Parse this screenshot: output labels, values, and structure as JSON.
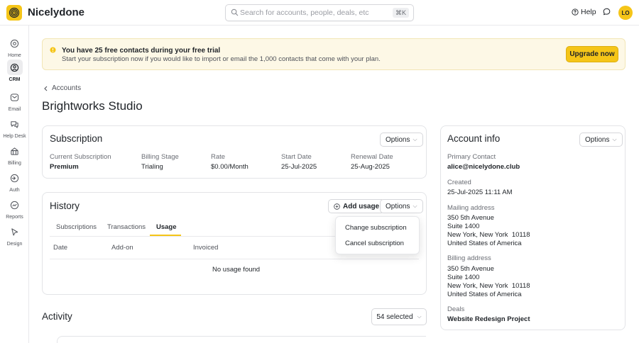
{
  "app": {
    "name": "Nicelydone"
  },
  "search": {
    "placeholder": "Search for accounts, people, deals, etc",
    "shortcut": "⌘K"
  },
  "header": {
    "help_label": "Help",
    "avatar_initials": "LO"
  },
  "sidebar": {
    "items": [
      {
        "label": "Home",
        "icon": "home-icon"
      },
      {
        "label": "CRM",
        "icon": "crm-icon",
        "active": true
      },
      {
        "label": "Email",
        "icon": "email-icon"
      },
      {
        "label": "Help Desk",
        "icon": "help-desk-icon"
      },
      {
        "label": "Billing",
        "icon": "billing-icon"
      },
      {
        "label": "Auth",
        "icon": "auth-icon"
      },
      {
        "label": "Reports",
        "icon": "reports-icon"
      },
      {
        "label": "Design",
        "icon": "design-icon"
      }
    ]
  },
  "banner": {
    "title": "You have 25 free contacts during your free trial",
    "subtitle": "Start your subscription now if you would like to import or email the 1,000 contacts that come with your plan.",
    "cta": "Upgrade now"
  },
  "breadcrumb": {
    "back_label": "Accounts"
  },
  "page": {
    "title": "Brightworks Studio"
  },
  "subscription": {
    "title": "Subscription",
    "options_label": "Options",
    "fields": [
      {
        "label": "Current Subscription",
        "value": "Premium"
      },
      {
        "label": "Billing Stage",
        "value": "Trialing"
      },
      {
        "label": "Rate",
        "value": "$0.00/Month"
      },
      {
        "label": "Start Date",
        "value": "25-Jul-2025"
      },
      {
        "label": "Renewal Date",
        "value": "25-Aug-2025"
      }
    ]
  },
  "history": {
    "title": "History",
    "add_usage_label": "Add usage",
    "options_label": "Options",
    "tabs": [
      {
        "label": "Subscriptions"
      },
      {
        "label": "Transactions"
      },
      {
        "label": "Usage",
        "active": true
      }
    ],
    "columns": [
      "Date",
      "Add-on",
      "Invoiced"
    ],
    "empty_text": "No usage found",
    "dropdown": [
      "Change subscription",
      "Cancel subscription"
    ]
  },
  "account_info": {
    "title": "Account info",
    "options_label": "Options",
    "primary_contact": {
      "label": "Primary Contact",
      "value": "alice@nicelydone.club"
    },
    "created": {
      "label": "Created",
      "value": "25-Jul-2025 11:11 AM"
    },
    "mailing_address": {
      "label": "Mailing address",
      "lines": [
        "350 5th Avenue",
        "Suite 1400",
        "New York, New York  10118",
        "United States of America"
      ]
    },
    "billing_address": {
      "label": "Billing address",
      "lines": [
        "350 5th Avenue",
        "Suite 1400",
        "New York, New York  10118",
        "United States of America"
      ]
    },
    "deals": {
      "label": "Deals",
      "value": "Website Redesign Project"
    }
  },
  "activity": {
    "title": "Activity",
    "selected_label": "54 selected"
  },
  "colors": {
    "accent": "#f5c518",
    "banner_bg": "#fdf8e6",
    "border": "#e3e4e7"
  }
}
